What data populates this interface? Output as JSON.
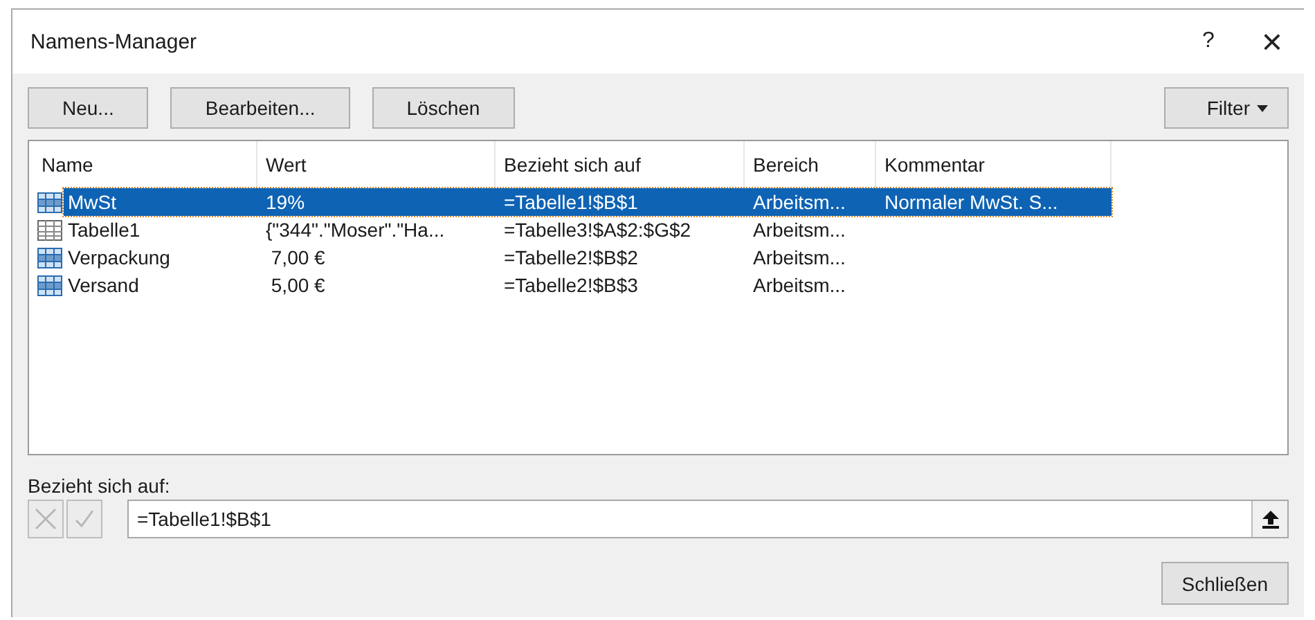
{
  "window": {
    "title": "Namens-Manager",
    "help": "?",
    "close": "×"
  },
  "toolbar": [
    "Neu...",
    "Bearbeiten...",
    "Löschen"
  ],
  "filter_button": {
    "label": "Filter"
  },
  "table": {
    "columns": [
      "Name",
      "Wert",
      "Bezieht sich auf",
      "Bereich",
      "Kommentar"
    ],
    "rows": [
      {
        "kind": "name",
        "selected": true,
        "cells": [
          "MwSt",
          "19%",
          "=Tabelle1!$B$1",
          "Arbeitsm...",
          "Normaler MwSt. S..."
        ]
      },
      {
        "kind": "table",
        "selected": false,
        "cells": [
          "Tabelle1",
          "{\"344\".\"Moser\".\"Ha...",
          "=Tabelle3!$A$2:$G$2",
          "Arbeitsm...",
          ""
        ]
      },
      {
        "kind": "name",
        "selected": false,
        "cells": [
          "Verpackung",
          " 7,00 €",
          "=Tabelle2!$B$2",
          "Arbeitsm...",
          ""
        ]
      },
      {
        "kind": "name",
        "selected": false,
        "cells": [
          "Versand",
          " 5,00 €",
          "=Tabelle2!$B$3",
          "Arbeitsm...",
          ""
        ]
      }
    ]
  },
  "refers_to": {
    "label": "Bezieht sich auf:",
    "value": "=Tabelle1!$B$1",
    "buttons_disabled": true
  },
  "close_button": "Schließen"
}
